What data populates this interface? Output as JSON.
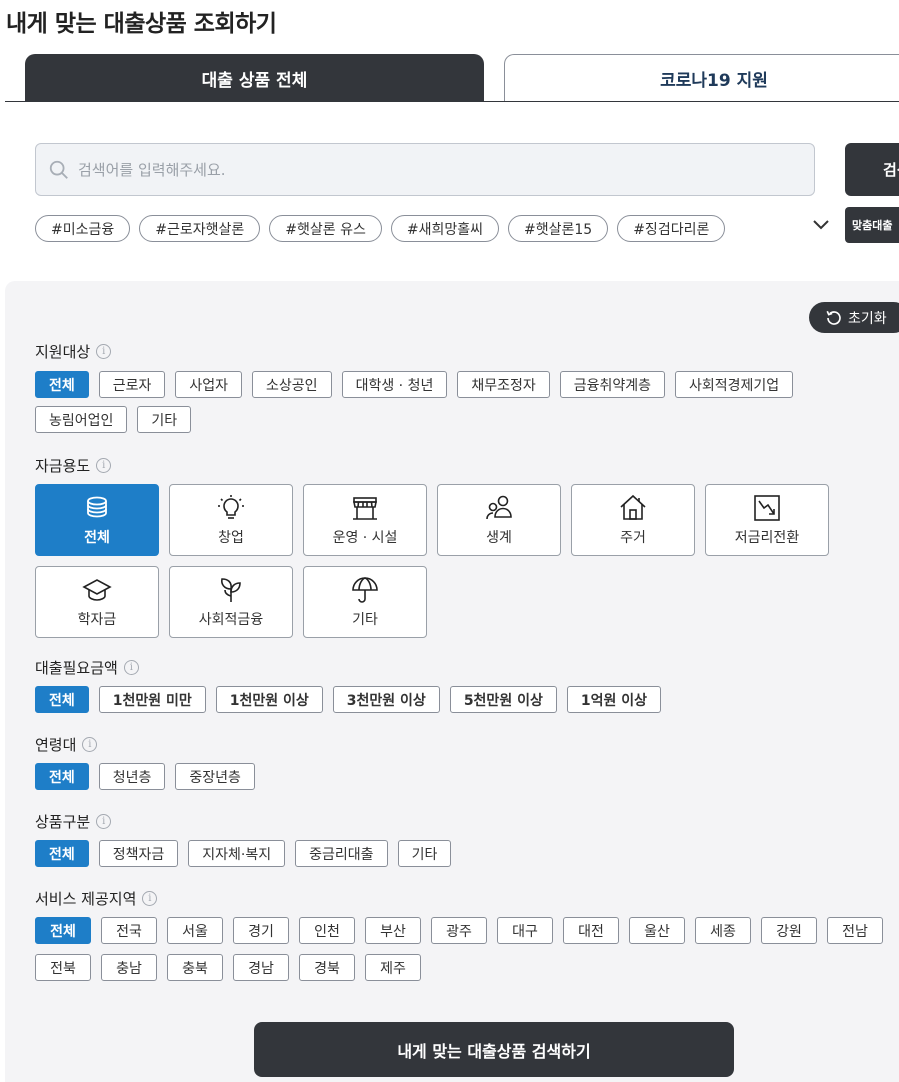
{
  "page_title": "내게 맞는 대출상품 조회하기",
  "tabs": [
    {
      "label": "대출 상품 전체",
      "active": true
    },
    {
      "label": "코로나19 지원",
      "active": false
    }
  ],
  "search": {
    "placeholder": "검색어를 입력해주세요.",
    "value": "",
    "button_label": "검색"
  },
  "hashtags": [
    "#미소금융",
    "#근로자햇살론",
    "#햇살론 유스",
    "#새희망홀씨",
    "#햇살론15",
    "#징검다리론"
  ],
  "match_button_label": "맞춤대출",
  "reset_label": "초기화",
  "filters": {
    "target": {
      "label": "지원대상",
      "options": [
        "전체",
        "근로자",
        "사업자",
        "소상공인",
        "대학생 · 청년",
        "채무조정자",
        "금융취약계층",
        "사회적경제기업",
        "농림어업인",
        "기타"
      ],
      "selected": "전체"
    },
    "usage": {
      "label": "자금용도",
      "options": [
        {
          "label": "전체",
          "icon": "coins-icon"
        },
        {
          "label": "창업",
          "icon": "lightbulb-icon"
        },
        {
          "label": "운영 · 시설",
          "icon": "store-icon"
        },
        {
          "label": "생계",
          "icon": "people-icon"
        },
        {
          "label": "주거",
          "icon": "house-icon"
        },
        {
          "label": "저금리전환",
          "icon": "trend-down-icon"
        },
        {
          "label": "학자금",
          "icon": "graduation-cap-icon"
        },
        {
          "label": "사회적금융",
          "icon": "sprout-icon"
        },
        {
          "label": "기타",
          "icon": "umbrella-icon"
        }
      ],
      "selected": "전체"
    },
    "amount": {
      "label": "대출필요금액",
      "options": [
        "전체",
        "1천만원 미만",
        "1천만원 이상",
        "3천만원 이상",
        "5천만원 이상",
        "1억원 이상"
      ],
      "selected": "전체"
    },
    "age": {
      "label": "연령대",
      "options": [
        "전체",
        "청년층",
        "중장년층"
      ],
      "selected": "전체"
    },
    "product_type": {
      "label": "상품구분",
      "options": [
        "전체",
        "정책자금",
        "지자체·복지",
        "중금리대출",
        "기타"
      ],
      "selected": "전체"
    },
    "region": {
      "label": "서비스 제공지역",
      "options": [
        "전체",
        "전국",
        "서울",
        "경기",
        "인천",
        "부산",
        "광주",
        "대구",
        "대전",
        "울산",
        "세종",
        "강원",
        "전남",
        "전북",
        "충남",
        "충북",
        "경남",
        "경북",
        "제주"
      ],
      "selected": "전체"
    }
  },
  "submit_label": "내게 맞는 대출상품 검색하기",
  "colors": {
    "dark": "#33363b",
    "accent_blue": "#1e7ec8",
    "panel_bg": "#f4f4f6"
  }
}
